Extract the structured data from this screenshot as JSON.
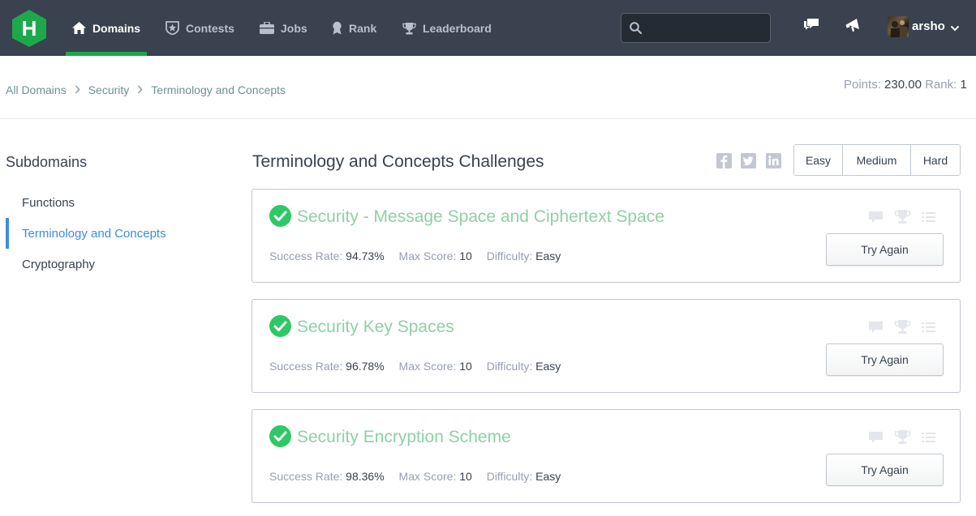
{
  "colors": {
    "nav_bg": "#39424e",
    "accent_green": "#1ba94c",
    "link_blue": "#3c8dde",
    "solved_title": "#8fd0a6"
  },
  "nav": {
    "logo_letter": "H",
    "items": [
      {
        "label": "Domains",
        "icon": "home-icon",
        "active": true
      },
      {
        "label": "Contests",
        "icon": "star-badge-icon",
        "active": false
      },
      {
        "label": "Jobs",
        "icon": "briefcase-icon",
        "active": false
      },
      {
        "label": "Rank",
        "icon": "medal-icon",
        "active": false
      },
      {
        "label": "Leaderboard",
        "icon": "trophy-icon",
        "active": false
      }
    ],
    "search": {
      "placeholder": "",
      "value": ""
    },
    "icons": [
      "chat-icon",
      "notification-icon"
    ],
    "user": {
      "name": "arsho"
    }
  },
  "breadcrumb": [
    "All Domains",
    "Security",
    "Terminology and Concepts"
  ],
  "stats": {
    "points_label": "Points:",
    "points": "230.00",
    "rank_label": "Rank:",
    "rank": "1"
  },
  "sidebar": {
    "title": "Subdomains",
    "items": [
      {
        "label": "Functions",
        "active": false
      },
      {
        "label": "Terminology and Concepts",
        "active": true
      },
      {
        "label": "Cryptography",
        "active": false
      }
    ]
  },
  "main": {
    "title": "Terminology and Concepts Challenges",
    "share": [
      "facebook-icon",
      "twitter-icon",
      "linkedin-icon"
    ],
    "difficulty_filters": [
      "Easy",
      "Medium",
      "Hard"
    ],
    "labels": {
      "success_rate": "Success Rate:",
      "max_score": "Max Score:",
      "difficulty": "Difficulty:"
    },
    "challenges": [
      {
        "title": "Security - Message Space and Ciphertext Space",
        "success_rate": "94.73%",
        "max_score": "10",
        "difficulty": "Easy",
        "action": "Try Again"
      },
      {
        "title": "Security Key Spaces",
        "success_rate": "96.78%",
        "max_score": "10",
        "difficulty": "Easy",
        "action": "Try Again"
      },
      {
        "title": "Security Encryption Scheme",
        "success_rate": "98.36%",
        "max_score": "10",
        "difficulty": "Easy",
        "action": "Try Again"
      }
    ]
  }
}
